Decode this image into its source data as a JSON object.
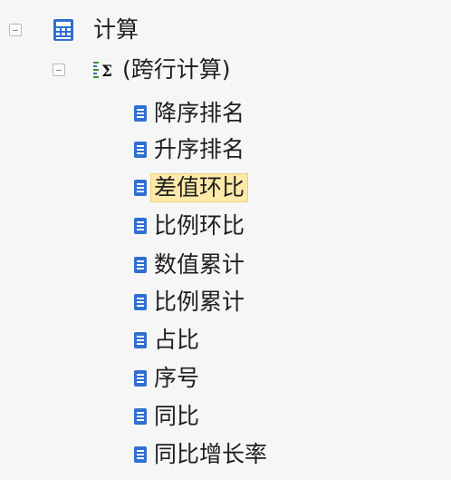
{
  "tree": {
    "root": {
      "label": "计算",
      "icon": "calculator-icon",
      "expanded": true
    },
    "group": {
      "label": "(跨行计算)",
      "icon": "sigma-icon",
      "expanded": true
    },
    "items": [
      {
        "label": "降序排名",
        "icon": "field-icon"
      },
      {
        "label": "升序排名",
        "icon": "field-icon"
      },
      {
        "label": "差值环比",
        "icon": "field-icon",
        "selected": true
      },
      {
        "label": "比例环比",
        "icon": "field-icon"
      },
      {
        "label": "数值累计",
        "icon": "field-icon"
      },
      {
        "label": "比例累计",
        "icon": "field-icon"
      },
      {
        "label": "占比",
        "icon": "field-icon"
      },
      {
        "label": "序号",
        "icon": "field-icon"
      },
      {
        "label": "同比",
        "icon": "field-icon"
      },
      {
        "label": "同比增长率",
        "icon": "field-icon"
      }
    ]
  },
  "colors": {
    "background": "#f6f6f6",
    "icon_blue": "#2f6fcf",
    "selection": "#fde9a8"
  }
}
